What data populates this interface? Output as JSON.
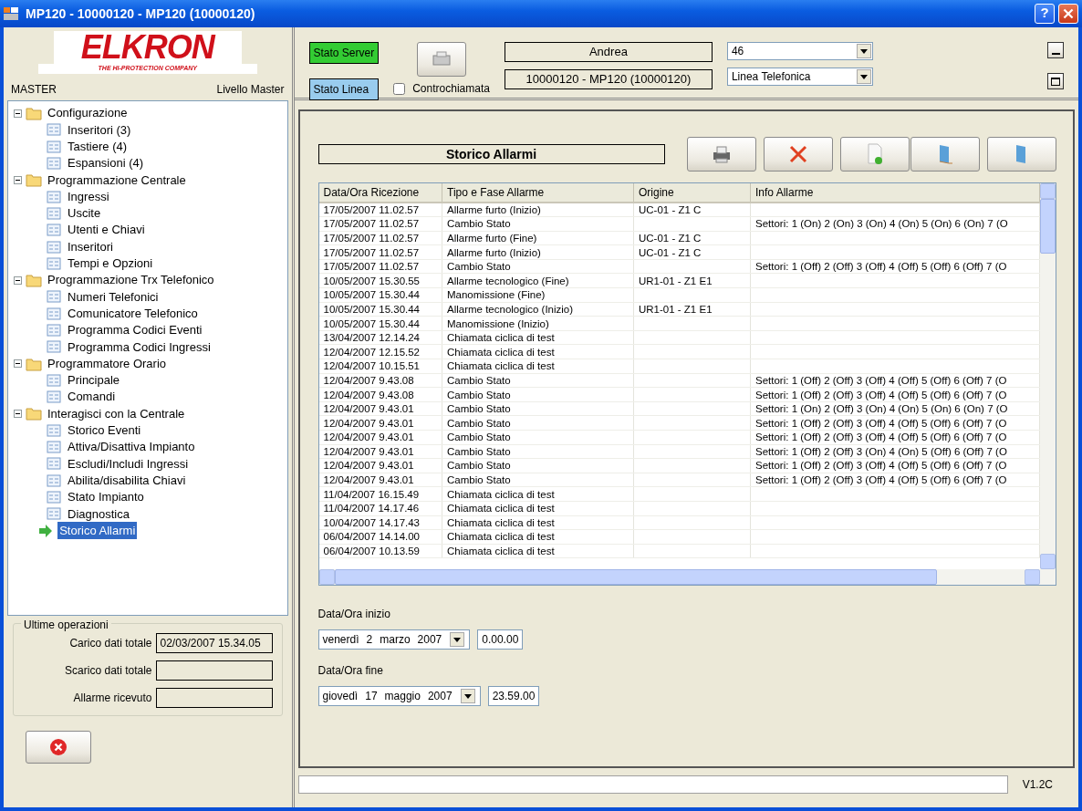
{
  "window": {
    "title": "MP120 - 10000120 - MP120 (10000120)",
    "help": "?"
  },
  "logo": {
    "brand": "ELKRON",
    "tagline": "THE HI-PROTECTION COMPANY"
  },
  "user": {
    "name": "MASTER",
    "level": "Livello Master"
  },
  "tree": [
    {
      "label": "Configurazione",
      "expanded": true,
      "selected": false,
      "children": [
        {
          "label": "Inseritori (3)",
          "selected": false
        },
        {
          "label": "Tastiere (4)",
          "selected": false
        },
        {
          "label": "Espansioni (4)",
          "selected": false
        }
      ]
    },
    {
      "label": "Programmazione Centrale",
      "expanded": true,
      "selected": false,
      "children": [
        {
          "label": "Ingressi",
          "selected": false
        },
        {
          "label": "Uscite",
          "selected": false
        },
        {
          "label": "Utenti e Chiavi",
          "selected": false
        },
        {
          "label": "Inseritori",
          "selected": false
        },
        {
          "label": "Tempi e Opzioni",
          "selected": false
        }
      ]
    },
    {
      "label": "Programmazione Trx Telefonico",
      "expanded": true,
      "selected": false,
      "children": [
        {
          "label": "Numeri Telefonici",
          "selected": false
        },
        {
          "label": "Comunicatore Telefonico",
          "selected": false
        },
        {
          "label": "Programma Codici Eventi",
          "selected": false
        },
        {
          "label": "Programma Codici Ingressi",
          "selected": false
        }
      ]
    },
    {
      "label": "Programmatore Orario",
      "expanded": true,
      "selected": false,
      "children": [
        {
          "label": "Principale",
          "selected": false
        },
        {
          "label": "Comandi",
          "selected": false
        }
      ]
    },
    {
      "label": "Interagisci con la Centrale",
      "expanded": true,
      "selected": false,
      "children": [
        {
          "label": "Storico Eventi",
          "selected": false
        },
        {
          "label": "Attiva/Disattiva Impianto",
          "selected": false
        },
        {
          "label": "Escludi/Includi Ingressi",
          "selected": false
        },
        {
          "label": "Abilita/disabilita Chiavi",
          "selected": false
        },
        {
          "label": "Stato Impianto",
          "selected": false
        },
        {
          "label": "Diagnostica",
          "selected": false
        }
      ]
    },
    {
      "label": "Storico Allarmi",
      "selected": true
    }
  ],
  "last_operations": {
    "title": "Ultime operazioni",
    "rows": [
      {
        "label": "Carico dati totale",
        "value": "02/03/2007 15.34.05"
      },
      {
        "label": "Scarico dati totale"
      },
      {
        "label": "Allarme ricevuto"
      }
    ]
  },
  "status": [
    {
      "label": "Stato Server",
      "color": "#33cc33"
    },
    {
      "label": "Stato Linea",
      "color": "#99ccee"
    }
  ],
  "callback": {
    "label": "Controchiamata",
    "checked": false
  },
  "info_fields": [
    "Andrea",
    "10000120 - MP120 (10000120)"
  ],
  "combos": [
    "46",
    "Linea Telefonica"
  ],
  "panel_title": "Storico Allarmi",
  "table": {
    "columns": [
      "Data/Ora Ricezione",
      "Tipo e Fase Allarme",
      "Origine",
      "Info Allarme"
    ],
    "rows": [
      [
        "17/05/2007 11.02.57",
        "Allarme furto  (Inizio)",
        "UC-01 - Z1 C",
        ""
      ],
      [
        "17/05/2007 11.02.57",
        "Cambio Stato",
        "",
        "Settori: 1 (On)  2 (On)  3 (On)  4 (On)  5 (On)  6 (On)  7 (O"
      ],
      [
        "17/05/2007 11.02.57",
        "Allarme furto  (Fine)",
        "UC-01 - Z1 C",
        ""
      ],
      [
        "17/05/2007 11.02.57",
        "Allarme furto  (Inizio)",
        "UC-01 - Z1 C",
        ""
      ],
      [
        "17/05/2007 11.02.57",
        "Cambio Stato",
        "",
        "Settori: 1 (Off)  2 (Off)  3 (Off)  4 (Off)  5 (Off)  6 (Off)  7 (O"
      ],
      [
        "10/05/2007 15.30.55",
        "Allarme tecnologico  (Fine)",
        "UR1-01 -  Z1 E1",
        ""
      ],
      [
        "10/05/2007 15.30.44",
        "Manomissione  (Fine)",
        "",
        ""
      ],
      [
        "10/05/2007 15.30.44",
        "Allarme tecnologico  (Inizio)",
        "UR1-01 -  Z1 E1",
        ""
      ],
      [
        "10/05/2007 15.30.44",
        "Manomissione  (Inizio)",
        "",
        ""
      ],
      [
        "13/04/2007 12.14.24",
        "Chiamata ciclica di test",
        "",
        ""
      ],
      [
        "12/04/2007 12.15.52",
        "Chiamata ciclica di test",
        "",
        ""
      ],
      [
        "12/04/2007 10.15.51",
        "Chiamata ciclica di test",
        "",
        ""
      ],
      [
        "12/04/2007 9.43.08",
        "Cambio Stato",
        "",
        "Settori: 1 (Off)  2 (Off)  3 (Off)  4 (Off)  5 (Off)  6 (Off)  7 (O"
      ],
      [
        "12/04/2007 9.43.08",
        "Cambio Stato",
        "",
        "Settori: 1 (Off)  2 (Off)  3 (Off)  4 (Off)  5 (Off)  6 (Off)  7 (O"
      ],
      [
        "12/04/2007 9.43.01",
        "Cambio Stato",
        "",
        "Settori: 1 (On)  2 (Off)  3 (On)  4 (On)  5 (On)  6 (On)  7 (O"
      ],
      [
        "12/04/2007 9.43.01",
        "Cambio Stato",
        "",
        "Settori: 1 (Off)  2 (Off)  3 (Off)  4 (Off)  5 (Off)  6 (Off)  7 (O"
      ],
      [
        "12/04/2007 9.43.01",
        "Cambio Stato",
        "",
        "Settori: 1 (Off)  2 (Off)  3 (Off)  4 (Off)  5 (Off)  6 (Off)  7 (O"
      ],
      [
        "12/04/2007 9.43.01",
        "Cambio Stato",
        "",
        "Settori: 1 (Off)  2 (Off)  3 (On)  4 (On)  5 (Off)  6 (Off)  7 (O"
      ],
      [
        "12/04/2007 9.43.01",
        "Cambio Stato",
        "",
        "Settori: 1 (Off)  2 (Off)  3 (Off)  4 (Off)  5 (Off)  6 (Off)  7 (O"
      ],
      [
        "12/04/2007 9.43.01",
        "Cambio Stato",
        "",
        "Settori: 1 (Off)  2 (Off)  3 (Off)  4 (Off)  5 (Off)  6 (Off)  7 (O"
      ],
      [
        "11/04/2007 16.15.49",
        "Chiamata ciclica di test",
        "",
        ""
      ],
      [
        "11/04/2007 14.17.46",
        "Chiamata ciclica di test",
        "",
        ""
      ],
      [
        "10/04/2007 14.17.43",
        "Chiamata ciclica di test",
        "",
        ""
      ],
      [
        "06/04/2007 14.14.00",
        "Chiamata ciclica di test",
        "",
        ""
      ],
      [
        "06/04/2007 10.13.59",
        "Chiamata ciclica di test",
        "",
        ""
      ]
    ]
  },
  "start": {
    "label": "Data/Ora inizio",
    "date": [
      "venerdì",
      "2",
      "marzo",
      "2007"
    ],
    "time": "0.00.00"
  },
  "end": {
    "label": "Data/Ora fine",
    "date": [
      "giovedì",
      "17",
      "maggio",
      "2007"
    ],
    "time": "23.59.00"
  },
  "version": "V1.2C"
}
